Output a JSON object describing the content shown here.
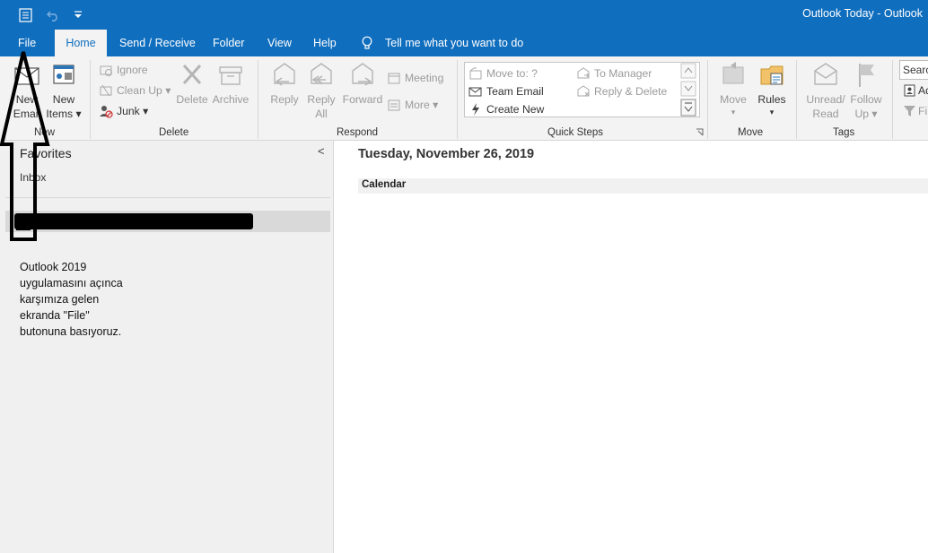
{
  "titlebar": {
    "title": "Outlook Today  -  Outlook",
    "icons": [
      "send-receive-all-icon",
      "undo-icon",
      "customize-quick-access-icon"
    ]
  },
  "tabs": [
    {
      "label": "File"
    },
    {
      "label": "Home",
      "active": true
    },
    {
      "label": "Send / Receive"
    },
    {
      "label": "Folder"
    },
    {
      "label": "View"
    },
    {
      "label": "Help"
    }
  ],
  "tellme": {
    "label": "Tell me what you want to do",
    "icon": "lightbulb-icon"
  },
  "ribbon": {
    "new": {
      "group_label": "New",
      "new_email": [
        "New",
        "Email"
      ],
      "new_items": [
        "New",
        "Items ▾"
      ]
    },
    "delete": {
      "group_label": "Delete",
      "ignore": "Ignore",
      "clean_up": "Clean Up ▾",
      "junk": "Junk ▾",
      "delete": "Delete",
      "archive": "Archive"
    },
    "respond": {
      "group_label": "Respond",
      "reply": "Reply",
      "reply_all": [
        "Reply",
        "All"
      ],
      "forward": "Forward",
      "meeting": "Meeting",
      "more": "More ▾"
    },
    "quick_steps": {
      "group_label": "Quick Steps",
      "items": [
        "Move to: ?",
        "Team Email",
        "Create New",
        "To Manager",
        "Reply & Delete"
      ]
    },
    "move": {
      "group_label": "Move",
      "move": [
        "Move",
        "▾"
      ],
      "rules": [
        "Rules",
        "▾"
      ]
    },
    "tags": {
      "group_label": "Tags",
      "unread_read": [
        "Unread/",
        "Read"
      ],
      "follow_up": [
        "Follow",
        "Up ▾"
      ]
    },
    "find": {
      "search_placeholder": "Search People",
      "address_book": "Ad",
      "filter": "Fi"
    }
  },
  "nav": {
    "favorites": "Favorites",
    "collapse": "<",
    "inbox": "Inbox",
    "caption": "Outlook 2019\nuygulamasını açınca\nkarşımıza gelen\nekranda \"File\"\nbutonuna basıyoruz."
  },
  "main": {
    "date": "Tuesday, November 26, 2019",
    "calendar_label": "Calendar"
  },
  "colors": {
    "accent": "#106ebe",
    "ribbon_bg": "#f3f3f3",
    "nav_bg": "#f0f0f0"
  }
}
